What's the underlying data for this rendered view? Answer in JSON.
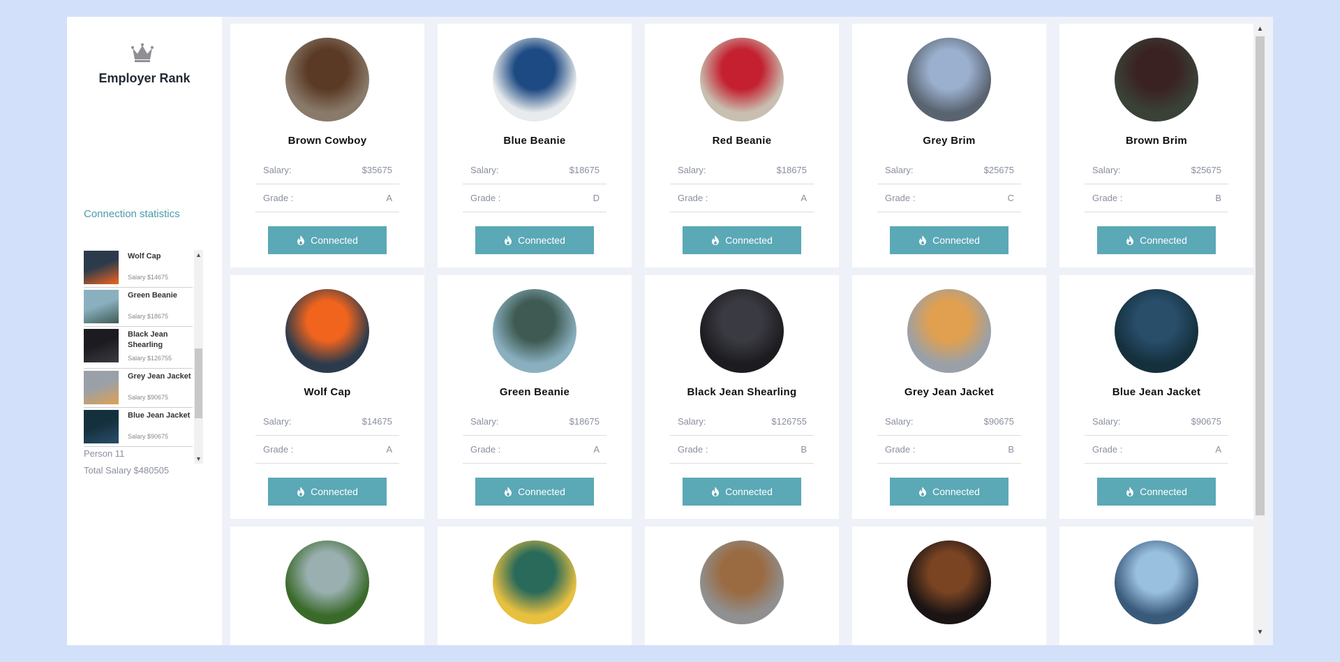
{
  "sidebar": {
    "brand_title": "Employer Rank",
    "brand_icon": "crown-icon",
    "connection_title": "Connection statistics",
    "connections": [
      {
        "name": "Wolf Cap",
        "salary": "Salary $14675",
        "colors": [
          "#2c3b4c",
          "#f0641e"
        ]
      },
      {
        "name": "Green Beanie",
        "salary": "Salary $18675",
        "colors": [
          "#8ab0c0",
          "#3e5a52"
        ]
      },
      {
        "name": "Black Jean Shearling",
        "salary": "Salary $126755",
        "colors": [
          "#1c1c20",
          "#3a3a42"
        ]
      },
      {
        "name": "Grey Jean Jacket",
        "salary": "Salary $90675",
        "colors": [
          "#9aa0a8",
          "#e0a050"
        ]
      },
      {
        "name": "Blue Jean Jacket",
        "salary": "Salary $90675",
        "colors": [
          "#15303d",
          "#284e6a"
        ]
      }
    ],
    "person": "Person 11",
    "total_salary": "Total Salary $480505"
  },
  "salary_label": "Salary:",
  "grade_label": "Grade :",
  "button_label": "Connected",
  "cards": [
    {
      "name": "Brown Cowboy",
      "salary": "$35675",
      "grade": "A",
      "colors": [
        "#8a7a6a",
        "#5a3a25"
      ]
    },
    {
      "name": "Blue Beanie",
      "salary": "$18675",
      "grade": "D",
      "colors": [
        "#e8ebed",
        "#1d4a82"
      ]
    },
    {
      "name": "Red Beanie",
      "salary": "$18675",
      "grade": "A",
      "colors": [
        "#c8bfb0",
        "#c42030"
      ]
    },
    {
      "name": "Grey Brim",
      "salary": "$25675",
      "grade": "C",
      "colors": [
        "#5a6470",
        "#9bb0cf"
      ]
    },
    {
      "name": "Brown Brim",
      "salary": "$25675",
      "grade": "B",
      "colors": [
        "#3a4238",
        "#3a2222"
      ]
    },
    {
      "name": "Wolf Cap",
      "salary": "$14675",
      "grade": "A",
      "colors": [
        "#2c3b4c",
        "#f0641e"
      ]
    },
    {
      "name": "Green Beanie",
      "salary": "$18675",
      "grade": "A",
      "colors": [
        "#8ab0c0",
        "#3e5a52"
      ]
    },
    {
      "name": "Black Jean Shearling",
      "salary": "$126755",
      "grade": "B",
      "colors": [
        "#1c1c20",
        "#3a3a42"
      ]
    },
    {
      "name": "Grey Jean Jacket",
      "salary": "$90675",
      "grade": "B",
      "colors": [
        "#9aa0a8",
        "#e0a050"
      ]
    },
    {
      "name": "Blue Jean Jacket",
      "salary": "$90675",
      "grade": "A",
      "colors": [
        "#15303d",
        "#284e6a"
      ]
    },
    {
      "name": "",
      "salary": "",
      "grade": "",
      "colors": [
        "#3a6a2a",
        "#9ab0b0"
      ]
    },
    {
      "name": "",
      "salary": "",
      "grade": "",
      "colors": [
        "#e8c040",
        "#2a6a5a"
      ]
    },
    {
      "name": "",
      "salary": "",
      "grade": "",
      "colors": [
        "#909090",
        "#9a6a40"
      ]
    },
    {
      "name": "",
      "salary": "",
      "grade": "",
      "colors": [
        "#1a1414",
        "#7a4422"
      ]
    },
    {
      "name": "",
      "salary": "",
      "grade": "",
      "colors": [
        "#3a5a7a",
        "#9ac0e0"
      ]
    }
  ]
}
